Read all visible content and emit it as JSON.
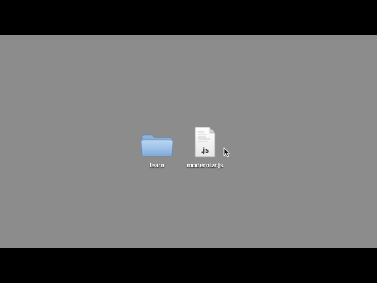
{
  "desktop": {
    "background_color": "#8c8c8c",
    "letterbox_color": "#000000",
    "items": [
      {
        "label": "learn",
        "icon": "folder-icon"
      },
      {
        "label": "modernizr.js",
        "icon": "js-file-icon",
        "badge": ".js"
      }
    ]
  },
  "cursor": {
    "icon": "arrow-cursor-icon"
  }
}
